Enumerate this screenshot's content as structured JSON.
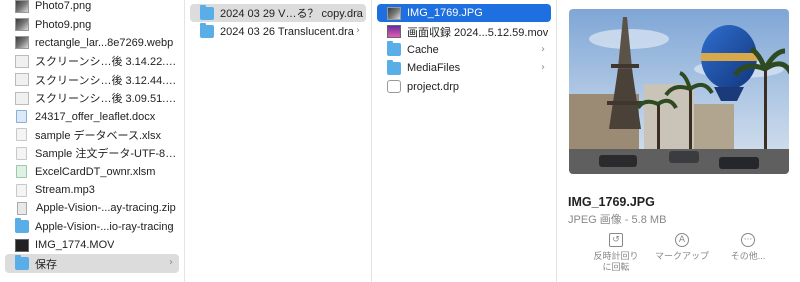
{
  "column1": [
    {
      "label": "Photo7.png",
      "icon": "image-file-icon",
      "kind": "img"
    },
    {
      "label": "Photo9.png",
      "icon": "image-file-icon",
      "kind": "img"
    },
    {
      "label": "rectangle_lar...8e7269.webp",
      "icon": "image-file-icon",
      "kind": "img"
    },
    {
      "label": "スクリーンシ…後 3.14.22.png",
      "icon": "screenshot-file-icon",
      "kind": "shot"
    },
    {
      "label": "スクリーンシ…後 3.12.44.png",
      "icon": "screenshot-file-icon",
      "kind": "shot"
    },
    {
      "label": "スクリーンシ…後 3.09.51.png",
      "icon": "screenshot-file-icon",
      "kind": "shot"
    },
    {
      "label": "24317_offer_leaflet.docx",
      "icon": "word-document-icon",
      "kind": "doc blue"
    },
    {
      "label": "sample データベース.xlsx",
      "icon": "document-icon",
      "kind": "doc"
    },
    {
      "label": "Sample 注文データ-UTF-8.csv",
      "icon": "document-icon",
      "kind": "doc"
    },
    {
      "label": "ExcelCardDT_ownr.xlsm",
      "icon": "spreadsheet-icon",
      "kind": "doc green"
    },
    {
      "label": "Stream.mp3",
      "icon": "audio-file-icon",
      "kind": "doc"
    },
    {
      "label": "Apple-Vision-...ay-tracing.zip",
      "icon": "zip-archive-icon",
      "kind": "zip"
    },
    {
      "label": "Apple-Vision-...io-ray-tracing",
      "icon": "folder-icon",
      "kind": "folder",
      "chevron": true
    },
    {
      "label": "IMG_1774.MOV",
      "icon": "movie-file-icon",
      "kind": "movie"
    },
    {
      "label": "保存",
      "icon": "folder-icon",
      "kind": "folder",
      "chevron": true,
      "selected": "gray"
    }
  ],
  "column2": [
    {
      "label": "2024 03 29 V…る？ copy.dra",
      "icon": "folder-icon",
      "kind": "folder",
      "chevron": true,
      "selected": "gray"
    },
    {
      "label": "2024 03 26 Translucent.dra",
      "icon": "folder-icon",
      "kind": "folder",
      "chevron": true
    }
  ],
  "column3": [
    {
      "label": "IMG_1769.JPG",
      "icon": "image-file-icon",
      "kind": "img",
      "selected": "blue"
    },
    {
      "label": "画面収録 2024...5.12.59.mov",
      "icon": "movie-file-icon",
      "kind": "movie2"
    },
    {
      "label": "Cache",
      "icon": "folder-icon",
      "kind": "folder",
      "chevron": true
    },
    {
      "label": "MediaFiles",
      "icon": "folder-icon",
      "kind": "folder",
      "chevron": true
    },
    {
      "label": "project.drp",
      "icon": "project-file-icon",
      "kind": "drp"
    }
  ],
  "preview": {
    "filename": "IMG_1769.JPG",
    "subtitle": "JPEG 画像 - 5.8 MB",
    "actions": [
      {
        "label_line1": "反時計回り",
        "label_line2": "に回転",
        "icon": "rotate-left-icon",
        "glyph": "↺"
      },
      {
        "label_line1": "マークアップ",
        "label_line2": "",
        "icon": "markup-icon",
        "glyph": "A"
      },
      {
        "label_line1": "その他...",
        "label_line2": "",
        "icon": "more-icon",
        "glyph": "···"
      }
    ]
  },
  "chevron_glyph": "›",
  "colors": {
    "selection_blue": "#1e6fe0",
    "selection_gray": "#dcdcdc",
    "folder": "#5aaee8"
  }
}
